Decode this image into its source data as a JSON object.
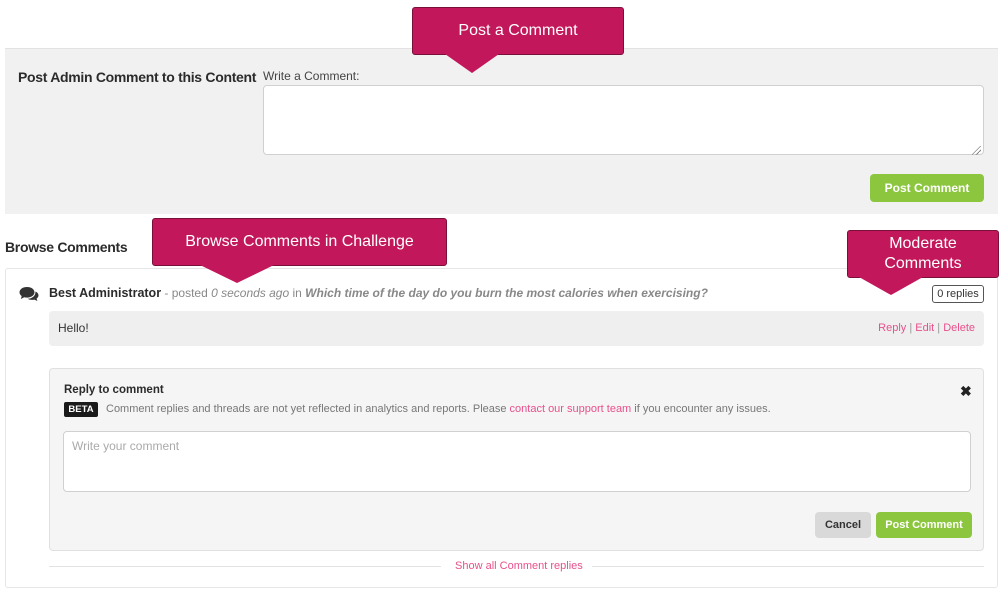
{
  "admin_panel": {
    "title": "Post Admin Comment to this Content",
    "write_label": "Write a Comment:",
    "textarea_value": "",
    "post_button": "Post Comment"
  },
  "browse": {
    "title": "Browse Comments"
  },
  "comment": {
    "author": "Best Administrator",
    "posted_prefix": " - posted ",
    "posted_time": "0 seconds ago",
    "in_word": " in ",
    "content_title": "Which time of the day do you burn the most calories when exercising?",
    "replies_badge": "0 replies",
    "text": "Hello!",
    "actions": {
      "reply": "Reply",
      "edit": "Edit",
      "delete": "Delete",
      "separator": " | "
    }
  },
  "reply_form": {
    "title": "Reply to comment",
    "beta_badge": "BETA",
    "note_prefix": "Comment replies and threads are not yet reflected in analytics and reports. Please ",
    "note_link": "contact our support team",
    "note_suffix": " if you encounter any issues.",
    "placeholder": "Write your comment",
    "cancel_button": "Cancel",
    "post_button": "Post Comment",
    "close_glyph": "✖"
  },
  "show_replies_link": "Show all Comment replies",
  "callouts": {
    "post": "Post a Comment",
    "browse": "Browse Comments in Challenge",
    "moderate_line1": "Moderate",
    "moderate_line2": "Comments"
  },
  "colors": {
    "accent_green": "#8cc63f",
    "link_pink": "#e8508b",
    "callout_magenta": "#c2185b"
  }
}
